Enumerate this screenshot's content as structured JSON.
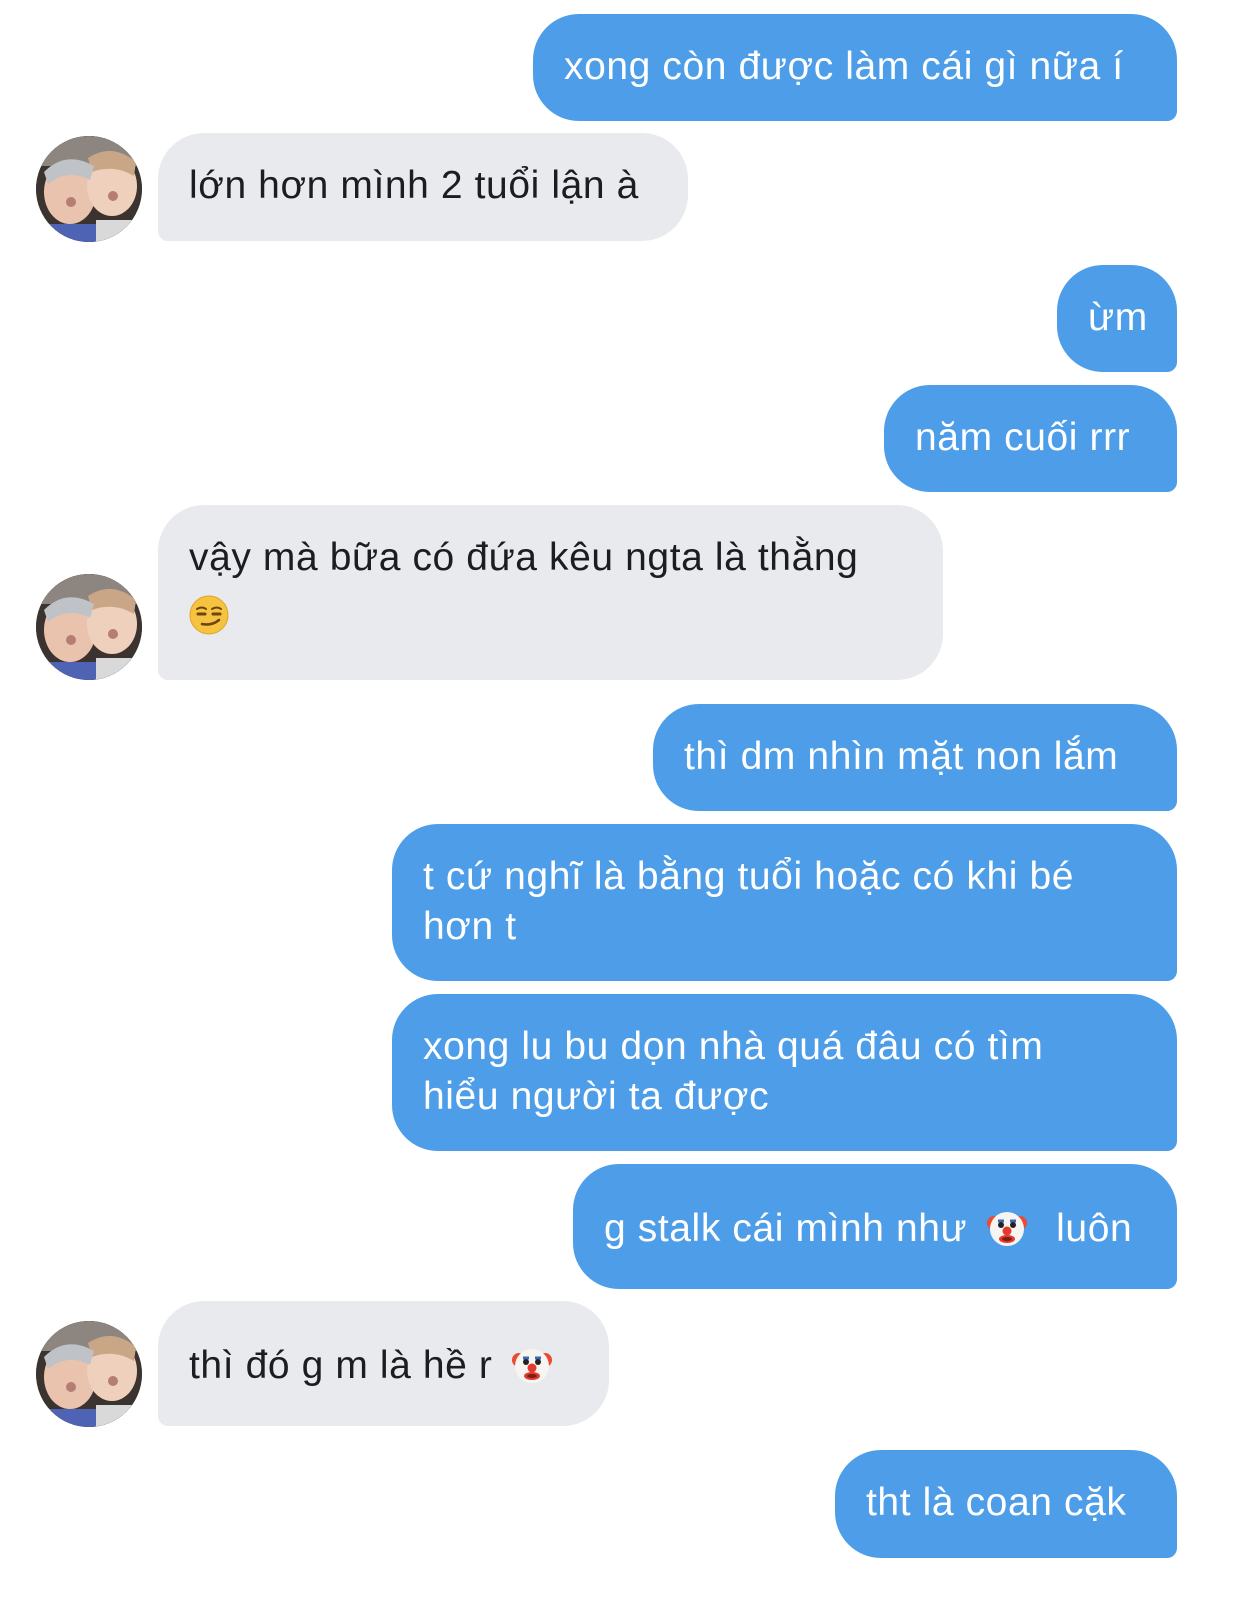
{
  "conversation": {
    "messages": [
      {
        "from": "me",
        "text": "xong còn được làm cái gì nữa í"
      },
      {
        "from": "them",
        "text": "lớn hơn mình 2 tuổi lận à"
      },
      {
        "from": "me",
        "text": "ừm"
      },
      {
        "from": "me",
        "text": "năm cuối rrr"
      },
      {
        "from": "them",
        "text": "vậy mà bữa có đứa kêu ngta là thằng",
        "emoji": "smirking-face-emoji"
      },
      {
        "from": "me",
        "text": "thì dm nhìn mặt non lắm"
      },
      {
        "from": "me",
        "line1": "t cứ nghĩ là bằng tuổi hoặc có khi bé",
        "line2": "hơn t"
      },
      {
        "from": "me",
        "line1": "xong lu bu dọn nhà quá đâu có tìm",
        "line2": "hiểu người ta được"
      },
      {
        "from": "me",
        "before": "g stalk cái mình như",
        "emoji": "clown-face-emoji",
        "after": "luôn"
      },
      {
        "from": "them",
        "text": "thì đó g m là hề r",
        "emoji": "clown-face-emoji"
      },
      {
        "from": "me",
        "text": "tht là coan cặk"
      }
    ]
  },
  "colors": {
    "sent_bubble": "#4d9de9",
    "received_bubble": "#e8eaee",
    "sent_text": "#ffffff",
    "received_text": "#1c1d1f"
  },
  "icons": {
    "avatar": "avatar-photo-icon",
    "smirk": "smirking-face-emoji",
    "clown": "clown-face-emoji"
  }
}
